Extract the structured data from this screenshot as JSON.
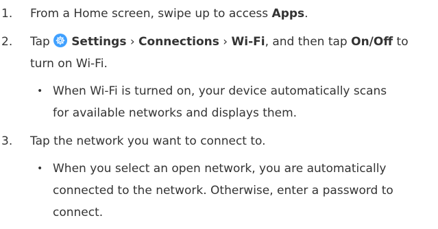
{
  "steps": [
    {
      "num": "1.",
      "pre": "From a Home screen, swipe up to access ",
      "apps": "Apps",
      "post": "."
    },
    {
      "num": "2.",
      "tap": "Tap ",
      "settings": "Settings",
      "sep1": " › ",
      "connections": "Connections",
      "sep2": " › ",
      "wifi": "Wi-Fi",
      "mid": ", and then tap ",
      "onoff": "On/Off",
      "to": " to",
      "line2": "turn on Wi-Fi.",
      "bullet_line1": "When Wi-Fi is turned on, your device automatically scans",
      "bullet_line2": "for available networks and displays them."
    },
    {
      "num": "3.",
      "text": "Tap the network you want to connect to.",
      "bullet_line1": "When you select an open network, you are automatically",
      "bullet_line2": "connected to the network. Otherwise, enter a password to",
      "bullet_line3": "connect."
    }
  ],
  "bullet_char": "•",
  "icons": {
    "settings": "gear-icon"
  },
  "colors": {
    "text": "#333333",
    "settings_icon": "#3fa0ff"
  }
}
